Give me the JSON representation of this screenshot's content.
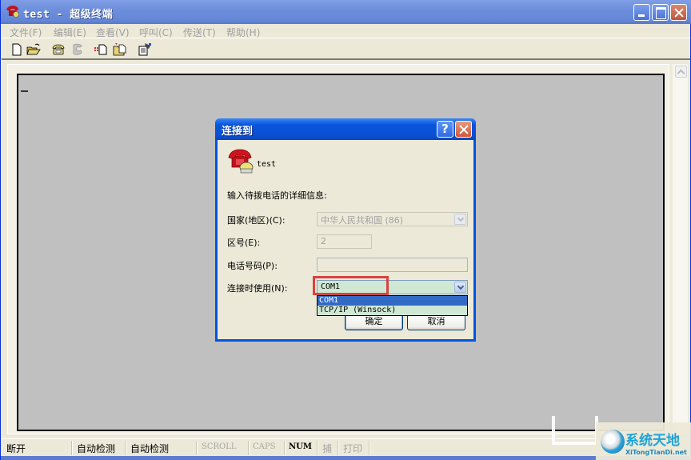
{
  "window": {
    "title": "test - 超级终端",
    "controls": {
      "minimize": "minimize",
      "maximize": "maximize",
      "close": "close"
    }
  },
  "menubar": {
    "items": [
      {
        "label": "文件(F)"
      },
      {
        "label": "编辑(E)"
      },
      {
        "label": "查看(V)"
      },
      {
        "label": "呼叫(C)"
      },
      {
        "label": "传送(T)"
      },
      {
        "label": "帮助(H)"
      }
    ]
  },
  "toolbar": {
    "icons": [
      "new-icon",
      "open-folder-icon",
      "dial-phone-icon",
      "disconnect-phone-icon",
      "send-file-icon",
      "receive-file-icon",
      "properties-icon"
    ]
  },
  "terminal": {
    "cursor": "_"
  },
  "dialog": {
    "title": "连接到",
    "help_label": "?",
    "connection_name": "test",
    "description": "输入待拨电话的详细信息:",
    "fields": {
      "country_label": "国家(地区)(C):",
      "country_value": "中华人民共和国 (86)",
      "area_label": "区号(E):",
      "area_value": "2",
      "phone_label": "电话号码(P):",
      "phone_value": "",
      "connect_label": "连接时使用(N):",
      "connect_value": "COM1"
    },
    "connect_options": [
      {
        "label": "COM1",
        "selected": true
      },
      {
        "label": "TCP/IP (Winsock)",
        "selected": false
      }
    ],
    "ok_label": "确定",
    "cancel_label": "取消",
    "highlight_color": "#d9423f"
  },
  "statusbar": {
    "cells": [
      {
        "label": "断开",
        "dim": false
      },
      {
        "label": "自动检测",
        "dim": false
      },
      {
        "label": "自动检测",
        "dim": false
      },
      {
        "label": "SCROLL",
        "dim": true
      },
      {
        "label": "CAPS",
        "dim": true
      },
      {
        "label": "NUM",
        "dim": false
      },
      {
        "label": "捕",
        "dim": true
      },
      {
        "label": "打印",
        "dim": true
      }
    ]
  },
  "watermark": {
    "title": "系统天地",
    "subtitle": "XiTongTianDi.net"
  }
}
